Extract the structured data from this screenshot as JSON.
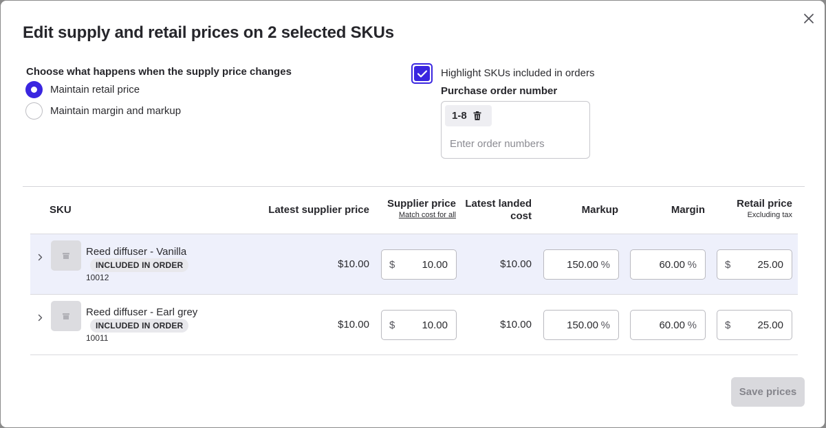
{
  "modal": {
    "title": "Edit supply and retail prices on 2 selected SKUs",
    "close_icon": "close-icon"
  },
  "supply_change": {
    "label": "Choose what happens when the supply price changes",
    "options": [
      {
        "label": "Maintain retail price",
        "selected": true
      },
      {
        "label": "Maintain margin and markup",
        "selected": false
      }
    ]
  },
  "highlight": {
    "label": "Highlight SKUs included in orders",
    "checked": true
  },
  "purchase_order": {
    "label": "Purchase order number",
    "tag": "1-8",
    "tag_icon": "trash-icon",
    "placeholder": "Enter order numbers"
  },
  "table": {
    "headers": {
      "sku": "SKU",
      "latest_supplier_price": "Latest supplier price",
      "supplier_price": "Supplier price",
      "match_cost_link": "Match cost for all",
      "latest_landed_cost_line1": "Latest landed",
      "latest_landed_cost_line2": "cost",
      "markup": "Markup",
      "margin": "Margin",
      "retail_price": "Retail price",
      "retail_price_sub": "Excluding tax"
    },
    "currency_symbol": "$",
    "percent_symbol": "%",
    "rows": [
      {
        "name": "Reed diffuser - Vanilla",
        "badge": "INCLUDED IN ORDER",
        "code": "10012",
        "latest_supplier_price": "$10.00",
        "supplier_price": "10.00",
        "latest_landed_cost": "$10.00",
        "markup": "150.00",
        "margin": "60.00",
        "retail_price": "25.00",
        "highlighted": true
      },
      {
        "name": "Reed diffuser - Earl grey",
        "badge": "INCLUDED IN ORDER",
        "code": "10011",
        "latest_supplier_price": "$10.00",
        "supplier_price": "10.00",
        "latest_landed_cost": "$10.00",
        "markup": "150.00",
        "margin": "60.00",
        "retail_price": "25.00",
        "highlighted": false
      }
    ]
  },
  "footer": {
    "save_label": "Save prices",
    "save_disabled": true
  },
  "colors": {
    "accent": "#3a26e0",
    "row_highlight": "#eef0fb"
  }
}
